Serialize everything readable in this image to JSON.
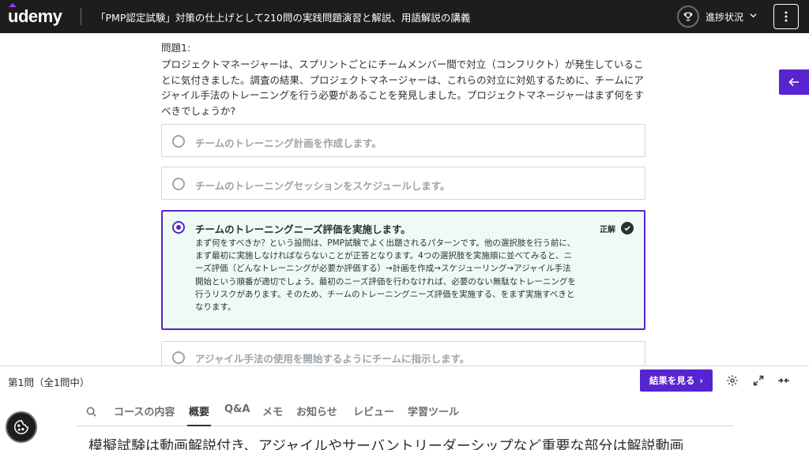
{
  "header": {
    "logo": "udemy",
    "course_title": "「PMP認定試験」対策の仕上げとして210問の実践問題演習と解説、用語解説の講義",
    "progress_label": "進捗状況",
    "icons": [
      "trophy-icon",
      "chevron-down-icon",
      "more-vertical-icon"
    ]
  },
  "quiz": {
    "question_number": "問題1:",
    "question_text": "プロジェクトマネージャーは、スプリントごとにチームメンバー間で対立（コンフリクト）が発生していることに気付きました。調査の結果、プロジェクトマネージャーは、これらの対立に対処するために、チームにアジャイル手法のトレーニングを行う必要があることを発見しました。プロジェクトマネージャーはまず何をすべきでしょうか?",
    "options": [
      {
        "label": "チームのトレーニング計画を作成します。",
        "selected": false
      },
      {
        "label": "チームのトレーニングセッションをスケジュールします。",
        "selected": false
      },
      {
        "label": "チームのトレーニングニーズ評価を実施します。",
        "selected": true
      },
      {
        "label": "アジャイル手法の使用を開始するようにチームに指示します。",
        "selected": false
      }
    ],
    "correct_label": "正解",
    "explanation": "まず何をすべきか？という設問は、PMP試験でよく出題されるパターンです。他の選択肢を行う前に、まず最初に実施しなければならないことが正答となります。4つの選択肢を実施順に並べてみると、ニーズ評価（どんなトレーニングが必要か評価する）→計画を作成→スケジューリング→アジャイル手法開始という順番が適切でしょう。最初のニーズ評価を行わなければ、必要のない無駄なトレーニングを行うリスクがあります。そのため、チームのトレーニングニーズ評価を実施する、をまず実施すべきとなります。"
  },
  "footer": {
    "question_count": "第1問（全1問中）",
    "results_button": "結果を見る",
    "results_chevron": "›"
  },
  "tabs": {
    "items": [
      "コースの内容",
      "概要",
      "Q&A",
      "メモ",
      "お知らせ",
      "レビュー",
      "学習ツール"
    ],
    "active": "概要"
  },
  "overview_text": "模擬試験は動画解説付き、アジャイルやサーバントリーダーシップなど重要な部分は解説動画",
  "colors": {
    "accent": "#5624d0",
    "header_bg": "#1c1d1f",
    "correct_bg": "#eefbf4"
  }
}
